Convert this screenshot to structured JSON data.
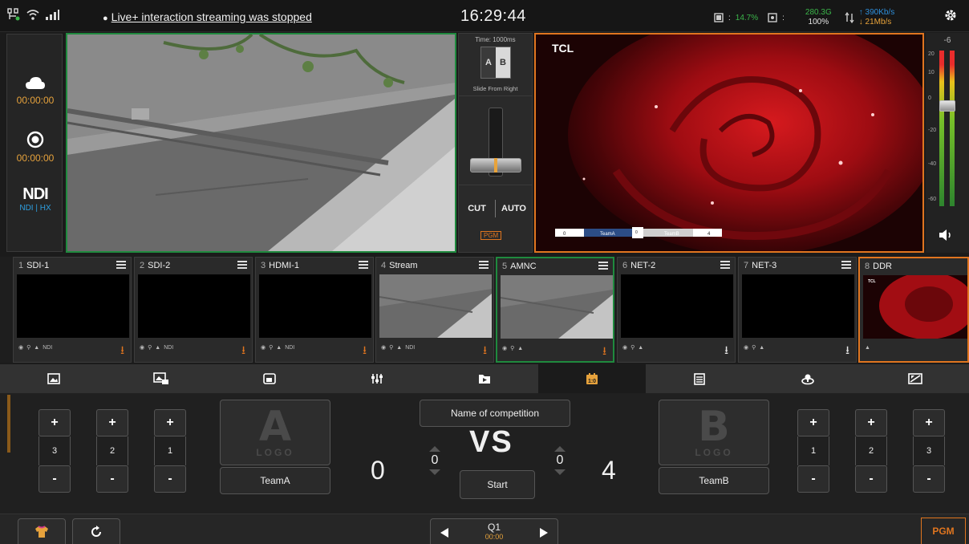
{
  "topbar": {
    "notice": "Live+ interaction streaming was stopped",
    "clock": "16:29:44",
    "cpu_label": ":",
    "cpu_value": "14.7%",
    "storage_label": ":",
    "storage_size": "280.3G",
    "storage_pct": "100%",
    "net_up": "↑ 390Kb/s",
    "net_down": "↓ 21Mb/s"
  },
  "status": {
    "stream_time": "00:00:00",
    "record_time": "00:00:00",
    "ndi_label": "NDI",
    "ndi_sub": "NDI | HX"
  },
  "program": {
    "watermark": "TCL",
    "score_a": "0",
    "team_a": "TeamA",
    "vs_small": "0",
    "team_b": "TeamB",
    "score_b": "4"
  },
  "transition": {
    "time_label": "Time: 1000ms",
    "a": "A",
    "b": "B",
    "name": "Slide From Right",
    "cut": "CUT",
    "auto": "AUTO",
    "pgm": "PGM"
  },
  "meter": {
    "top": "-6",
    "scale": [
      "20",
      "10",
      "0",
      "-20",
      "-40",
      "-60"
    ]
  },
  "sources": [
    {
      "num": "1",
      "name": "SDI-1",
      "ndi": "NDI"
    },
    {
      "num": "2",
      "name": "SDI-2",
      "ndi": "NDI"
    },
    {
      "num": "3",
      "name": "HDMI-1",
      "ndi": "NDI"
    },
    {
      "num": "4",
      "name": "Stream",
      "ndi": "NDI"
    },
    {
      "num": "5",
      "name": "AMNC",
      "ndi": ""
    },
    {
      "num": "6",
      "name": "NET-2",
      "ndi": ""
    },
    {
      "num": "7",
      "name": "NET-3",
      "ndi": ""
    },
    {
      "num": "8",
      "name": "DDR",
      "ndi": ""
    }
  ],
  "tabs": [
    {
      "icon": "image-icon"
    },
    {
      "icon": "overlay-image-icon"
    },
    {
      "icon": "pip-icon"
    },
    {
      "icon": "audio-mixer-icon"
    },
    {
      "icon": "folder-icon"
    },
    {
      "icon": "scoreboard-icon"
    },
    {
      "icon": "notes-icon"
    },
    {
      "icon": "stream-icon"
    },
    {
      "icon": "color-key-icon"
    }
  ],
  "scoreboard": {
    "team_a": {
      "steppers": [
        {
          "plus": "+",
          "value": "3",
          "minus": "-"
        },
        {
          "plus": "+",
          "value": "2",
          "minus": "-"
        },
        {
          "plus": "+",
          "value": "1",
          "minus": "-"
        }
      ],
      "logo_letter": "A",
      "logo_word": "LOGO",
      "name": "TeamA",
      "score": "0",
      "sub_score": "0"
    },
    "competition_name": "Name of competition",
    "vs": "VS",
    "start": "Start",
    "team_b": {
      "steppers": [
        {
          "plus": "+",
          "value": "1",
          "minus": "-"
        },
        {
          "plus": "+",
          "value": "2",
          "minus": "-"
        },
        {
          "plus": "+",
          "value": "3",
          "minus": "-"
        }
      ],
      "logo_letter": "B",
      "logo_word": "LOGO",
      "name": "TeamB",
      "score": "4",
      "sub_score": "0"
    }
  },
  "bottom": {
    "quarter": "Q1",
    "quarter_time": "00:00",
    "pgm": "PGM"
  },
  "colors": {
    "preview_border": "#1f8a3e",
    "program_border": "#e0751f",
    "accent_orange": "#e6a23c",
    "accent_blue": "#2e9fe0"
  }
}
